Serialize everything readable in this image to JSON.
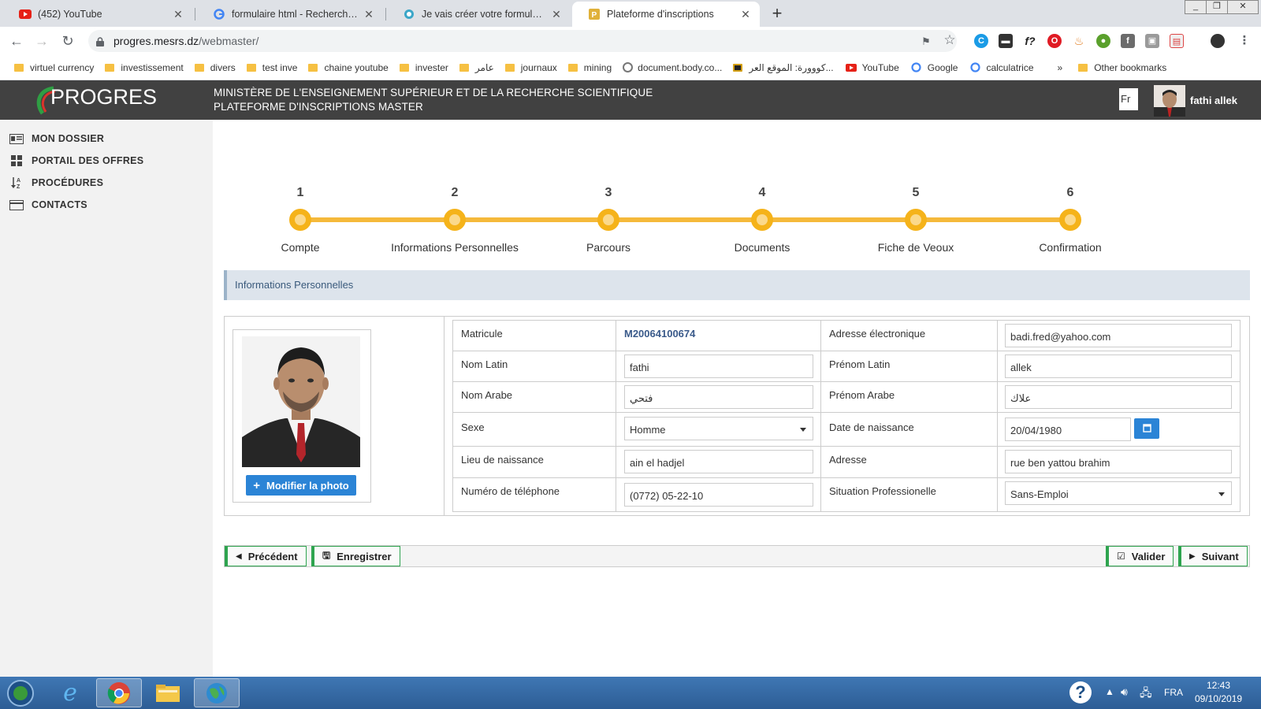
{
  "browser": {
    "tabs": [
      {
        "title": "(452) YouTube",
        "icon": "youtube-icon",
        "active": false
      },
      {
        "title": "formulaire html - Recherche Goo",
        "icon": "google-icon",
        "active": false
      },
      {
        "title": "Je vais créer votre formulaire htm",
        "icon": "fiverr-icon",
        "active": false
      },
      {
        "title": "Plateforme d'inscriptions",
        "icon": "progres-icon",
        "active": true
      }
    ],
    "url_host": "progres.mesrs.dz",
    "url_path": "/webmaster/",
    "bookmarks": [
      "virtuel currency",
      "investissement",
      "divers",
      "test inve",
      "chaine youtube",
      "invester",
      "عامر",
      "journaux",
      "mining",
      "document.body.co...",
      "كووورة: الموقع العر...",
      "YouTube",
      "Google",
      "calculatrice"
    ],
    "bookmarks_more": "»",
    "other_bookmarks": "Other bookmarks",
    "close_glyph": "✕",
    "new_tab_glyph": "+"
  },
  "header": {
    "logo": "PROGRES",
    "ministry": "MINISTÈRE DE L'ENSEIGNEMENT SUPÉRIEUR ET DE LA RECHERCHE SCIENTIFIQUE",
    "platform": "PLATEFORME D'INSCRIPTIONS MASTER",
    "lang": "Fr",
    "user": "fathi allek"
  },
  "sidebar": {
    "items": [
      {
        "label": "MON DOSSIER",
        "icon": "folder-list-icon"
      },
      {
        "label": "PORTAIL DES OFFRES",
        "icon": "windows-grid-icon"
      },
      {
        "label": "PROCÉDURES",
        "icon": "sort-az-icon"
      },
      {
        "label": "CONTACTS",
        "icon": "card-icon"
      }
    ]
  },
  "stepper": {
    "steps": [
      {
        "num": "1",
        "label": "Compte"
      },
      {
        "num": "2",
        "label": "Informations Personnelles"
      },
      {
        "num": "3",
        "label": "Parcours"
      },
      {
        "num": "4",
        "label": "Documents"
      },
      {
        "num": "5",
        "label": "Fiche de Veoux"
      },
      {
        "num": "6",
        "label": "Confirmation"
      }
    ]
  },
  "section_title": "Informations Personnelles",
  "photo": {
    "button": "Modifier la photo",
    "button_icon": "+"
  },
  "form": {
    "matricule_label": "Matricule",
    "matricule": "M20064100674",
    "email_label": "Adresse électronique",
    "email": "badi.fred@yahoo.com",
    "nom_latin_label": "Nom Latin",
    "nom_latin": "fathi",
    "prenom_latin_label": "Prénom Latin",
    "prenom_latin": "allek",
    "nom_arabe_label": "Nom Arabe",
    "nom_arabe": "فتحي",
    "prenom_arabe_label": "Prénom Arabe",
    "prenom_arabe": "علاك",
    "sexe_label": "Sexe",
    "sexe": "Homme",
    "date_label": "Date de naissance",
    "date": "20/04/1980",
    "lieu_label": "Lieu de naissance",
    "lieu": "ain el hadjel",
    "adresse_label": "Adresse",
    "adresse": "rue ben yattou brahim",
    "tel_label": "Numéro de téléphone",
    "tel": "(0772) 05-22-10",
    "situation_label": "Situation Professionelle",
    "situation": "Sans-Emploi"
  },
  "actions": {
    "prev": "Précédent",
    "save": "Enregistrer",
    "validate": "Valider",
    "next": "Suivant"
  },
  "taskbar": {
    "lang": "FRA",
    "time": "12:43",
    "date": "09/10/2019",
    "help": "?"
  },
  "colors": {
    "header_bg": "#414141",
    "stepper_accent": "#f5b31a",
    "primary_button": "#2b84d6",
    "action_border": "#2ea44f"
  }
}
